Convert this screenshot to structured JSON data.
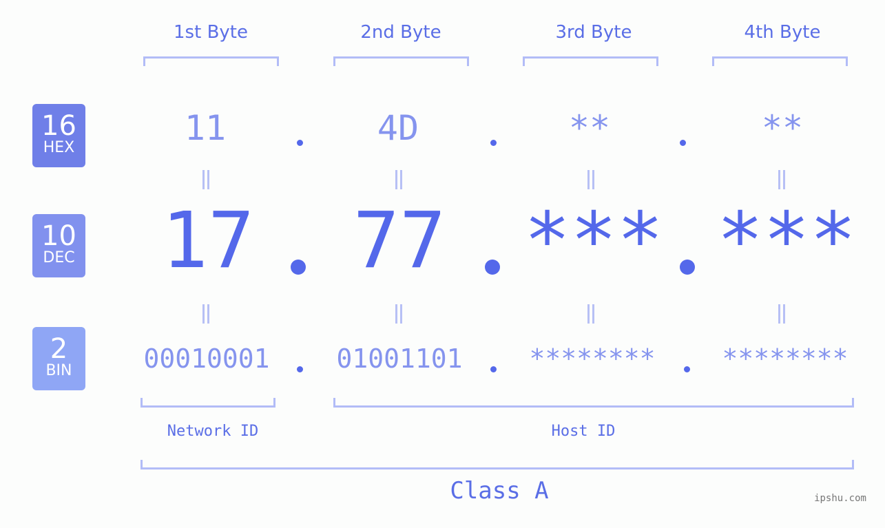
{
  "colors": {
    "accent": "#5468ea",
    "light_accent": "#8594ee",
    "bracket": "#b2bcf7",
    "hex_badge": "#6f7fe8",
    "dec_badge": "#8191ee",
    "bin_badge": "#8fa6f5",
    "background": "#fcfdfc"
  },
  "headers": [
    "1st Byte",
    "2nd Byte",
    "3rd Byte",
    "4th Byte"
  ],
  "badges": [
    {
      "num": "16",
      "label": "HEX"
    },
    {
      "num": "10",
      "label": "DEC"
    },
    {
      "num": "2",
      "label": "BIN"
    }
  ],
  "rows": {
    "hex": [
      "11",
      "4D",
      "**",
      "**"
    ],
    "dec": [
      "17",
      "77",
      "***",
      "***"
    ],
    "bin": [
      "00010001",
      "01001101",
      "********",
      "********"
    ]
  },
  "labels": {
    "network_id": "Network ID",
    "host_id": "Host ID",
    "class": "Class A"
  },
  "watermark": "ipshu.com"
}
